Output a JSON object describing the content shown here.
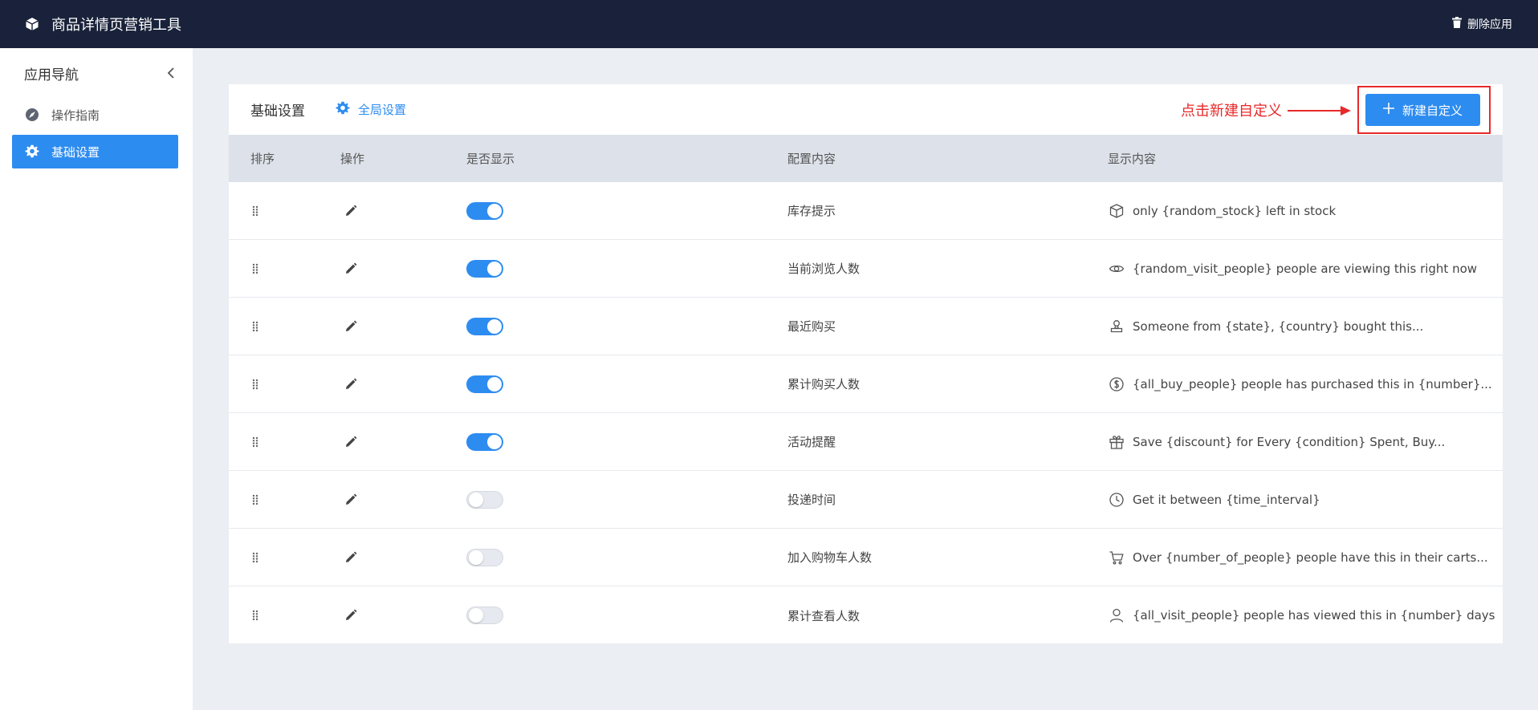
{
  "topbar": {
    "title": "商品详情页营销工具",
    "logo_icon": "cube-icon",
    "delete_label": "删除应用",
    "delete_icon": "trash-icon"
  },
  "sidebar": {
    "title": "应用导航",
    "items": [
      {
        "label": "操作指南",
        "icon": "compass-icon",
        "active": false
      },
      {
        "label": "基础设置",
        "icon": "gear-icon",
        "active": true
      }
    ]
  },
  "card": {
    "title": "基础设置",
    "global_settings_label": "全局设置",
    "hint": "点击新建自定义",
    "new_button_label": "新建自定义"
  },
  "table": {
    "headers": {
      "sort": "排序",
      "action": "操作",
      "visible": "是否显示",
      "config": "配置内容",
      "display": "显示内容"
    },
    "rows": [
      {
        "config": "库存提示",
        "display": "only {random_stock} left in stock",
        "enabled": true,
        "icon": "box-icon"
      },
      {
        "config": "当前浏览人数",
        "display": "{random_visit_people} people are viewing this right now",
        "enabled": true,
        "icon": "eye-icon"
      },
      {
        "config": "最近购买",
        "display": "Someone from {state}, {country} bought this...",
        "enabled": true,
        "icon": "stamp-icon"
      },
      {
        "config": "累计购买人数",
        "display": "{all_buy_people} people has purchased this in {number}...",
        "enabled": true,
        "icon": "dollar-icon"
      },
      {
        "config": "活动提醒",
        "display": "Save {discount} for Every {condition} Spent, Buy...",
        "enabled": true,
        "icon": "gift-icon"
      },
      {
        "config": "投递时间",
        "display": "Get it between {time_interval}",
        "enabled": false,
        "icon": "clock-icon"
      },
      {
        "config": "加入购物车人数",
        "display": "Over {number_of_people} people have this in their carts...",
        "enabled": false,
        "icon": "cart-icon"
      },
      {
        "config": "累计查看人数",
        "display": "{all_visit_people} people has viewed this in {number} days",
        "enabled": false,
        "icon": "user-icon"
      }
    ]
  },
  "colors": {
    "primary": "#2d8cf0",
    "topbar": "#19223a",
    "annotation": "#e8292a"
  }
}
